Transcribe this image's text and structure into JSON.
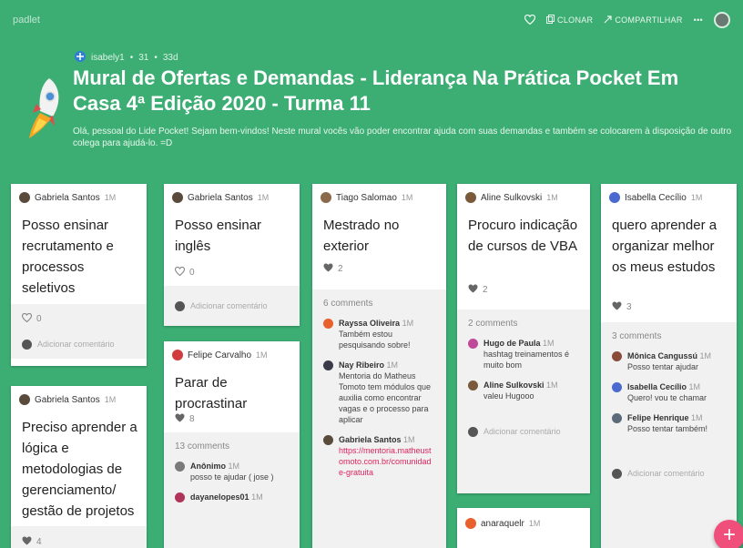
{
  "app": {
    "brand": "padlet"
  },
  "toolbar": {
    "clone_label": "CLONAR",
    "share_label": "COMPARTILHAR",
    "more_label": "•••"
  },
  "header": {
    "author": "isabely1",
    "count": "31",
    "age": "33d",
    "title": "Mural de Ofertas e Demandas - Liderança Na Prática Pocket Em Casa 4ª Edição 2020 - Turma 11",
    "description": "Olá, pessoal do Lide Pocket! Sejam bem-vindos! Neste mural vocês vão poder encontrar ajuda com suas demandas e também se colocarem à disposição de outro colega para ajudá-lo. =D"
  },
  "add_comment_label": "Adicionar comentário",
  "comments_suffix": "comments",
  "posts": [
    {
      "author": "Gabriela Santos",
      "time": "1M",
      "color": "#5a4a3c",
      "text": "Posso ensinar recrutamento e processos seletivos",
      "likes": "0",
      "liked": false
    },
    {
      "author": "Gabriela Santos",
      "time": "1M",
      "color": "#5a4a3c",
      "text": "Preciso aprender a lógica e metodologias de gerenciamento/ gestão de projetos",
      "likes": "4",
      "liked": true
    },
    {
      "author": "Gabriela Santos",
      "time": "1M",
      "color": "#5a4a3c",
      "text": "Posso ensinar inglês",
      "likes": "0",
      "liked": false
    },
    {
      "author": "Felipe Carvalho",
      "time": "1M",
      "color": "#d23b3b",
      "text": "Parar de procrastinar",
      "likes": "8",
      "liked": true,
      "comment_count": "13 comments",
      "comments": [
        {
          "author": "Anônimo",
          "time": "1M",
          "color": "#7a7a7a",
          "text": "posso te ajudar ( jose )"
        },
        {
          "author": "dayanelopes01",
          "time": "1M",
          "color": "#b0345a",
          "text": ""
        }
      ]
    },
    {
      "author": "Tiago Salomao",
      "time": "1M",
      "color": "#8a6a4a",
      "text": "Mestrado no exterior",
      "likes": "2",
      "liked": true,
      "comment_count": "6 comments",
      "comments": [
        {
          "author": "Rayssa Oliveira",
          "time": "1M",
          "color": "#e8602c",
          "text": "Também estou pesquisando sobre!"
        },
        {
          "author": "Nay Ribeiro",
          "time": "1M",
          "color": "#3a3a4a",
          "text": "Mentoria do Matheus Tomoto tem módulos que auxilia como encontrar vagas e o processo para aplicar"
        },
        {
          "author": "Gabriela Santos",
          "time": "1M",
          "color": "#5a4a3c",
          "text": "",
          "link": "https://mentoria.matheustomoto.com.br/comunidade-gratuita"
        }
      ]
    },
    {
      "author": "Aline Sulkovski",
      "time": "1M",
      "color": "#7a5a3a",
      "text": "Procuro indicação de cursos de VBA",
      "likes": "2",
      "liked": true,
      "comment_count": "2 comments",
      "comments": [
        {
          "author": "Hugo de Paula",
          "time": "1M",
          "color": "#c04a9a",
          "text": "hashtag treinamentos é muito bom"
        },
        {
          "author": "Aline Sulkovski",
          "time": "1M",
          "color": "#7a5a3a",
          "text": "valeu Hugooo"
        }
      ]
    },
    {
      "author": "anaraquelr",
      "time": "1M",
      "color": "#e8602c",
      "text": "",
      "likes": "",
      "liked": false
    },
    {
      "author": "Isabella Cecílio",
      "time": "1M",
      "color": "#4a6ad0",
      "text": "quero aprender a organizar melhor os meus estudos",
      "likes": "3",
      "liked": true,
      "comment_count": "3 comments",
      "comments": [
        {
          "author": "Mônica Cangussú",
          "time": "1M",
          "color": "#8a4a3a",
          "text": "Posso tentar ajudar"
        },
        {
          "author": "Isabella Cecílio",
          "time": "1M",
          "color": "#4a6ad0",
          "text": "Quero! vou te chamar"
        },
        {
          "author": "Felipe Henrique",
          "time": "1M",
          "color": "#5a6a7a",
          "text": "Posso tentar também!"
        }
      ]
    }
  ],
  "fab_label": "+",
  "colors": {
    "background": "#3cae74",
    "fab": "#f04e7b",
    "link": "#e0245e"
  }
}
